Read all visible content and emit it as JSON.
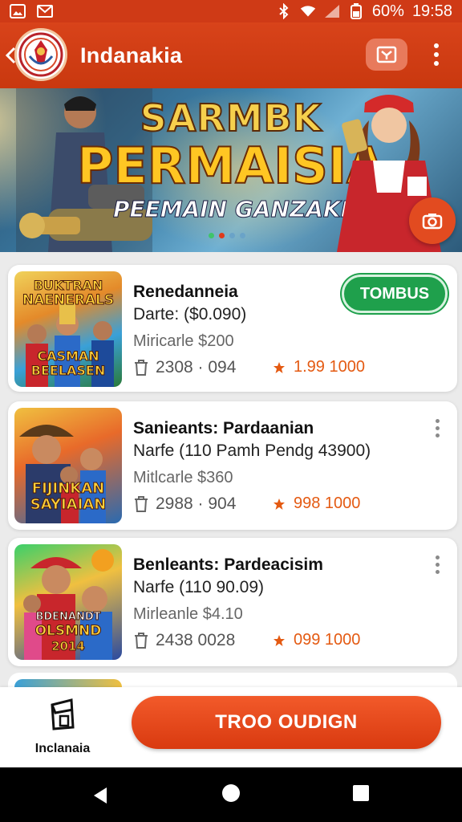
{
  "status_bar": {
    "battery": "60%",
    "time": "19:58"
  },
  "app_bar": {
    "title": "Indanakia"
  },
  "banner": {
    "line1": "SARMBK",
    "line2": "PERMAISIA",
    "line3": "PEEMAIN GANZAKI"
  },
  "list": [
    {
      "title": "Renedanneia",
      "subtitle": "Darte: ($0.090)",
      "price": "Miricarle $200",
      "meta": "2308 · 094",
      "rating": "1.99 1000",
      "action_label": "TOMBUS",
      "thumb_text": [
        "BUKTRAN",
        "NAENERALS",
        "CASMAN",
        "BEELASEN"
      ]
    },
    {
      "title": "Sanieants: Pardaanian",
      "subtitle": "Narfe (110 Pamh Pendg 43900)",
      "price": "Mitlcarle $360",
      "meta": "2988 · 904",
      "rating": "998 1000",
      "thumb_text": [
        "FIJINKAN",
        "SAYIAIAN"
      ]
    },
    {
      "title": "Benleants: Pardeacisim",
      "subtitle": "Narfe (110 90.09)",
      "price": "Mirleanle $4.10",
      "meta": "2438  0028",
      "rating": "099 1000",
      "thumb_text": [
        "BDENANDT",
        "OLSMND",
        "2014"
      ]
    }
  ],
  "bottom_bar": {
    "nav_label": "Inclanaia",
    "cta_label": "TROO OUDIGN"
  },
  "colors": {
    "brand": "#d8431a",
    "accent_green": "#1fa04c",
    "rating_orange": "#e45a12"
  },
  "icons": {
    "status_left": [
      "image-icon",
      "gmail-icon"
    ],
    "status_right": [
      "bluetooth-icon",
      "wifi-icon",
      "signal-icon",
      "battery-icon"
    ],
    "app_bar": [
      "back-arrow-icon",
      "cast-icon",
      "more-vert-icon"
    ],
    "banner": [
      "camera-icon"
    ],
    "card": [
      "trash-icon",
      "star-icon",
      "more-vert-icon"
    ],
    "bottom": [
      "store-icon"
    ],
    "system_nav": [
      "back-icon",
      "home-icon",
      "recents-icon"
    ]
  }
}
